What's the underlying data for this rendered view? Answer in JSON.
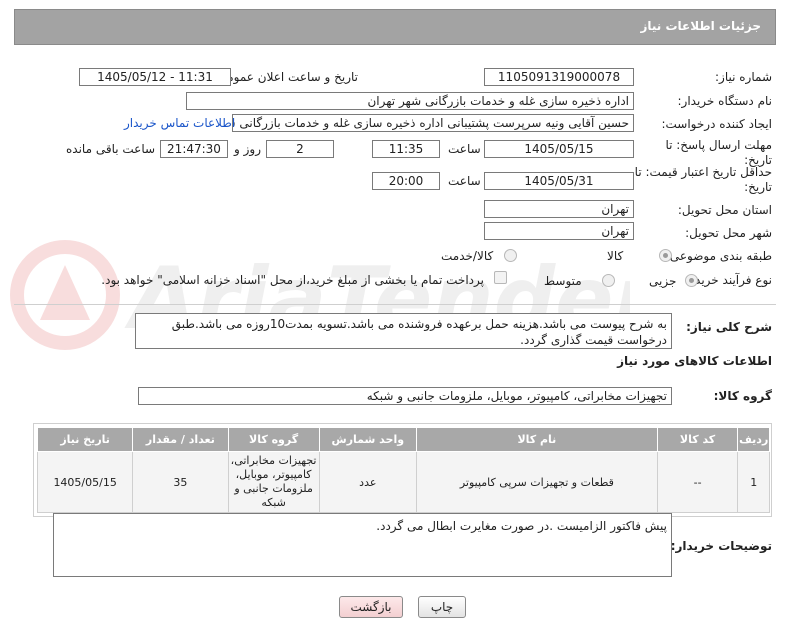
{
  "header": {
    "title": "جزئیات اطلاعات نیاز"
  },
  "form": {
    "need_number_label": "شماره نیاز:",
    "need_number": "1105091319000078",
    "announce_label": "تاریخ و ساعت اعلان عمومی:",
    "announce_value": "1405/05/12 - 11:31",
    "buyer_label": "نام دستگاه خریدار:",
    "buyer_value": "اداره ذخیره سازی غله و خدمات بازرگانی شهر تهران",
    "creator_label": "ایجاد کننده درخواست:",
    "creator_value": "حسین آقایی ونیه سرپرست پشتیبانی اداره ذخیره سازی غله و خدمات بازرگانی شهر تهران",
    "contact_link": "اطلاعات تماس خریدار",
    "deadline_label": "مهلت ارسال پاسخ: تا تاریخ:",
    "deadline_date": "1405/05/15",
    "time_label": "ساعت",
    "deadline_time": "11:35",
    "days_value": "2",
    "days_label": "روز و",
    "remaining_value": "21:47:30",
    "remaining_label": "ساعت باقی مانده",
    "validity_label": "حداقل تاریخ اعتبار قیمت: تا تاریخ:",
    "validity_date": "1405/05/31",
    "validity_time_label": "ساعت",
    "validity_time": "20:00",
    "province_label": "استان محل تحویل:",
    "province_value": "تهران",
    "city_label": "شهر محل تحویل:",
    "city_value": "تهران",
    "category_label": "طبقه بندی موضوعی:",
    "category_options": [
      "کالا",
      "کالا/خدمت"
    ],
    "process_label": "نوع فرآیند خرید :",
    "process_options": [
      "جزیی",
      "متوسط"
    ],
    "payment_note": "پرداخت تمام یا بخشی از مبلغ خرید،از محل \"اسناد خزانه اسلامی\" خواهد بود."
  },
  "description": {
    "label": "شرح کلی نیاز:",
    "text": "به شرح پیوست می باشد.هزینه حمل برعهده فروشنده می باشد.تسویه بمدت10روزه می باشد.طبق درخواست قیمت گذاری گردد."
  },
  "goods": {
    "section_title": "اطلاعات کالاهای مورد نیاز",
    "group_label": "گروه کالا:",
    "group_value": "تجهیزات مخابراتی، کامپیوتر، موبایل، ملزومات جانبی و شبکه",
    "columns": [
      "ردیف",
      "کد کالا",
      "نام کالا",
      "واحد شمارش",
      "گروه کالا",
      "تعداد / مقدار",
      "تاریخ نیاز"
    ],
    "rows": [
      [
        "1",
        "--",
        "قطعات و تجهیزات سرپی کامپیوتر",
        "عدد",
        "تجهیزات مخابراتی، کامپیوتر، موبایل، ملزومات جانبی و شبکه",
        "35",
        "1405/05/15"
      ]
    ]
  },
  "buyer_notes": {
    "label": "توضیحات خریدار:",
    "text": "پیش فاکتور الزامیست .در صورت مغایرت ابطال می گردد."
  },
  "buttons": {
    "print": "چاپ",
    "back": "بازگشت"
  },
  "colors": {
    "header_bg": "#a3a3a3",
    "link": "#1a55c9",
    "table_header": "#a8a8a8"
  }
}
